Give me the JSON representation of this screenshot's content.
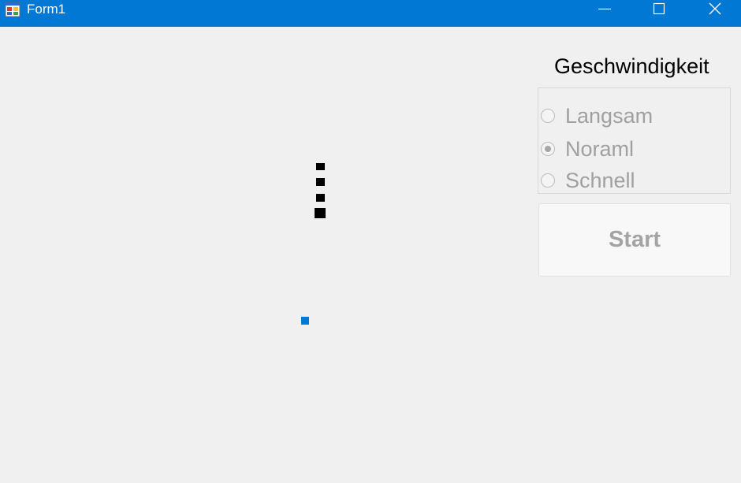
{
  "window": {
    "title": "Form1",
    "titlebar_color": "#0078d4",
    "icon": "form-app-icon",
    "controls": [
      "minimize-icon",
      "maximize-icon",
      "close-icon"
    ]
  },
  "speed": {
    "heading": "Geschwindigkeit",
    "options": [
      {
        "label": "Langsam",
        "checked": false
      },
      {
        "label": "Noraml",
        "checked": true
      },
      {
        "label": "Schnell",
        "checked": false
      }
    ],
    "enabled": false
  },
  "start_button": {
    "label": "Start",
    "enabled": false
  },
  "game": {
    "snake_length": 4,
    "snake_color": "#000000",
    "food_color": "#0078d4"
  }
}
